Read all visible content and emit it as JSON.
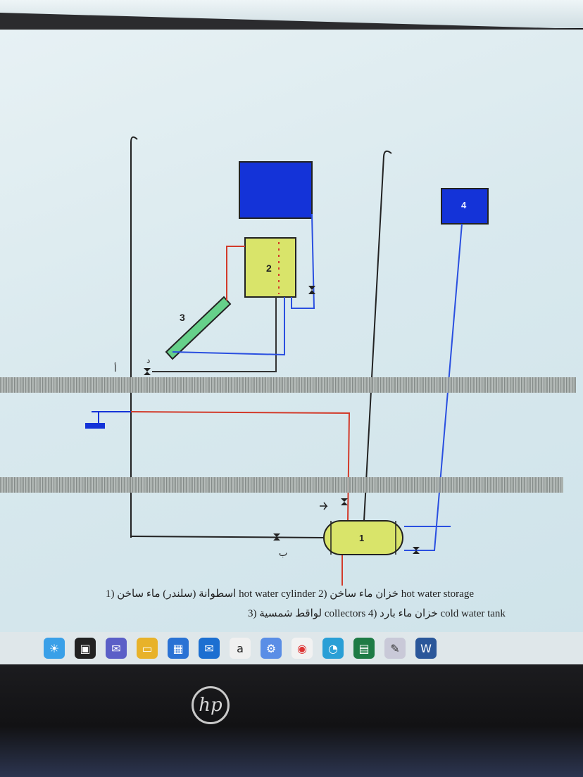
{
  "diagram": {
    "labels": {
      "cylinder": "1",
      "hot_storage": "2",
      "collector": "3",
      "cold_tank": "4",
      "point_a": "أ",
      "point_b": "ب",
      "point_d": "د"
    }
  },
  "caption": {
    "line1": "1) اسطوانة (سلندر) ماء ساخن hot water cylinder   2) خزان ماء ساخن hot water storage",
    "line2": "3) لواقط شمسية collectors   4) خزان ماء بارد cold water tank"
  },
  "taskbar": {
    "icons": [
      "widgets-icon",
      "task-view-icon",
      "chat-icon",
      "file-explorer-icon",
      "store-icon",
      "mail-icon",
      "amazon-icon",
      "settings-icon",
      "chrome-icon",
      "edge-icon",
      "excel-icon",
      "paint-icon",
      "word-icon"
    ],
    "amazon_letter": "a"
  },
  "brand": {
    "logo_text": "hp"
  },
  "colors": {
    "hot_pipe": "#d23a2a",
    "cold_pipe": "#2a4fe0",
    "tank_fill": "#d9e46a",
    "cold_tank_fill": "#1433d8",
    "collector_fill": "#66d08a"
  }
}
